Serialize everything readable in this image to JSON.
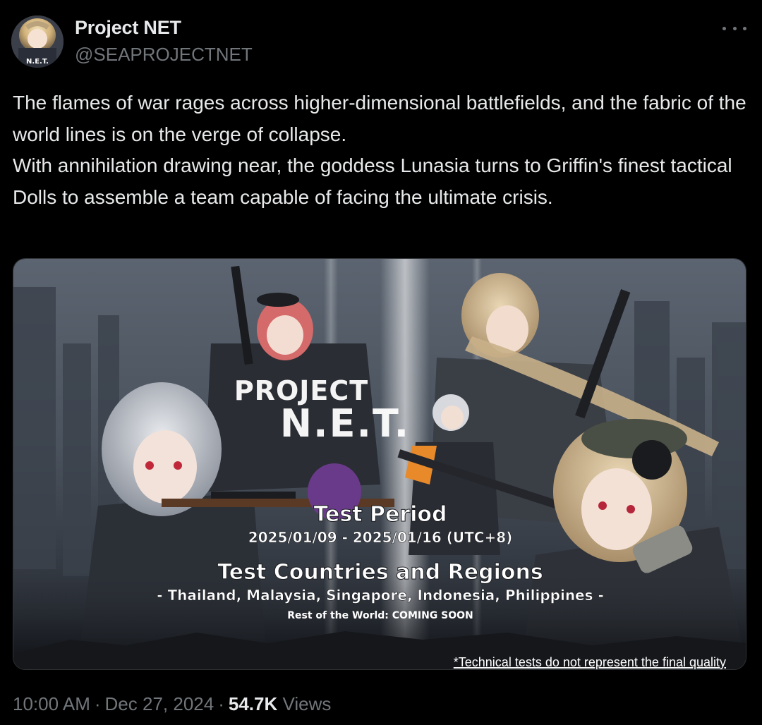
{
  "author": {
    "display_name": "Project NET",
    "handle": "@SEAPROJECTNET",
    "avatar_text": "N.E.T."
  },
  "tweet": {
    "text": "The flames of war rages across higher-dimensional battlefields, and the fabric of the world lines is on the verge of collapse.\nWith annihilation drawing near, the goddess Lunasia turns to Griffin's finest tactical Dolls to assemble a team capable of facing the ultimate crisis."
  },
  "media": {
    "logo_line1": "PROJECT",
    "logo_line2": "N.E.T.",
    "test_period_title": "Test Period",
    "test_period_dates": "2025/01/09 - 2025/01/16 (UTC+8)",
    "regions_title": "Test Countries and Regions",
    "regions_list": "- Thailand, Malaysia, Singapore, Indonesia, Philippines -",
    "rest_of_world": "Rest of the World: COMING SOON",
    "disclaimer": "*Technical tests do not represent the final quality"
  },
  "meta": {
    "time": "10:00 AM",
    "date": "Dec 27, 2024",
    "views_count": "54.7K",
    "views_label": "Views",
    "separator": "·"
  },
  "icons": {
    "more": "more-horizontal-icon"
  },
  "colors": {
    "background": "#000000",
    "primary_text": "#e7e9ea",
    "secondary_text": "#71767b",
    "border": "#2f3336"
  }
}
